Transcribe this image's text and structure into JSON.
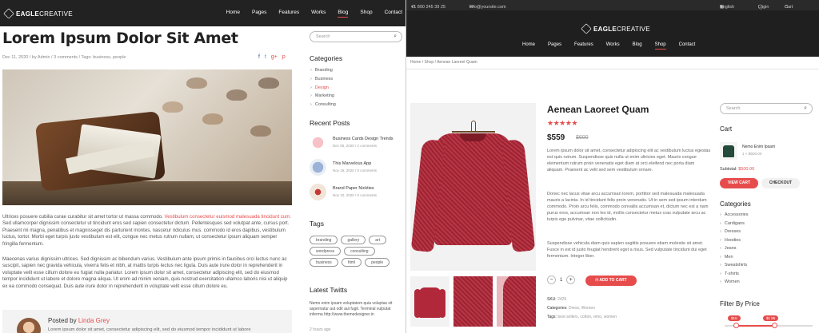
{
  "left": {
    "logo": {
      "bold": "EAGLE",
      "thin": "CREATIVE"
    },
    "nav": [
      "Home",
      "Pages",
      "Features",
      "Works",
      "Blog",
      "Shop",
      "Contact"
    ],
    "nav_active": "Blog",
    "post_title": "Lorem Ipsum Dolor Sit Amet",
    "meta": "Dec 11, 2020 / by Admin / 3 comments / Tags: business, people",
    "share_icons": [
      "facebook-icon",
      "twitter-icon",
      "google-plus-icon",
      "pinterest-icon"
    ],
    "share_glyphs": [
      "f",
      "t",
      "g+",
      "p"
    ],
    "para1_a": "Ultrices posuere cubilia curae curabitur sit amet tortor ut massa commodo. ",
    "para1_link": "Vestibulum consectetur euismod malesuada tincidunt cum.",
    "para1_b": " Sed ullamcorper dignissim consectetur ut tincidunt eros sed sapien consectetur dictum. Pellentesques sed volutpat ante, cursus port. Praesent mi magna, penatibus et magnisseget dis parturient montes, nascetur ridiculus mus. commodo id eros dapibus, vestibulum luctus, tortor. Morbi eget turpis justo vestibulum est elit, congue nec metus rutrum nullam, ut consectetur ipsum aliquam semper fringilla fermentum.",
    "para2": "Maecenas varius dignissim ultrices. Sed dignissim ac bibendum varius. Vestibulum ante ipsum primis in faucibus orci luctus nunc ac suscipit, sapien nec gravida vehicula, viverra felis et nibh, at mattis turpis lectus nec ligula. Duis aute irure dolor in reprehenderit in voluptate velit esse cillum dolore eu fugiat nulla pariatur. Lorem ipsum dolor sit amet, consectetur adipiscing elit, sed do eiusmod tempor incididunt ut labore et dolore magna aliqua. Ut enim ad minim veniam, quis nostrud exercitation ullamco laboris nisi ut aliquip ex ea commodo consequat. Duis aute irure dolor in reprehenderit in voluptate velit esse cillum dolore eu.",
    "author": {
      "posted_by": "Posted by ",
      "name": "Linda Grey",
      "text": "Lorem ipsum dolor sit amet, consectetur adipiscing elit, sed do eiusmod tempor incididunt ut labore"
    },
    "sidebar": {
      "search_placeholder": "Search",
      "categories_title": "Categories",
      "categories": [
        "Branding",
        "Business",
        "Design",
        "Marketing",
        "Consulting"
      ],
      "categories_active": "Design",
      "recent_title": "Recent Posts",
      "recent": [
        {
          "title": "Business Cards Design Trends",
          "date": "Dec 05, 2020 / 2 comments"
        },
        {
          "title": "This Marvelous App",
          "date": "Nov 16, 2020 / 0 comments"
        },
        {
          "title": "Brand Paper Nickties",
          "date": "Nov 10, 2020 / 0 comments"
        }
      ],
      "tags_title": "Tags",
      "tags": [
        "branding",
        "gallery",
        "art",
        "wordpress",
        "consulting",
        "business",
        "html",
        "people"
      ],
      "twitts_title": "Latest Twitts",
      "twitt": "Nemo enim ipsam voluptatem quia voluptas sit aspernatur aut odit aut fugit. Terminal vulputat inferma http://www.themedesigner.in",
      "twitt_time": "2 hours ago"
    }
  },
  "right": {
    "topbar": {
      "phone": "+1 800 245 39 25",
      "email": "info@yoursite.com",
      "language": "English",
      "login": "Login",
      "cart": "Cart"
    },
    "logo": {
      "bold": "EAGLE",
      "thin": "CREATIVE"
    },
    "nav": [
      "Home",
      "Pages",
      "Features",
      "Works",
      "Blog",
      "Shop",
      "Contact"
    ],
    "nav_active": "Shop",
    "breadcrumb": "Home / Shop / Aenean Laoreet Quam",
    "product": {
      "title": "Aenean Laoreet Quam",
      "rating": 4.5,
      "rating_max": 5,
      "price": "$559",
      "old_price": "$600",
      "desc1": "Lorem ipsum dolor sit amet, consectetur adipiscing elit ac vestibulum luctus egestas est quis rutrum. Suspendisse quis nulla ut enim ultricies eget. Mauris congue elementum rutrum proin venenatis eget diam at orci eleifend nec porta diam aliquam. Praesent ac velit sed sem vestibulum ornare.",
      "desc2": "Donec nec lacus vitae arcu accumsan lorem, porttitor sed malesuada malesuada mauris a lacinia. In id tincidunt felis proin venenatis. Ut in sem sed ipsum interdum commodo. Proin arcu felis, commodo convallis accumsan et, dictum nec est a nam purus eros, accumsan non leo id, mollis consectetur metus cras vulputate arcu ac turpis ege pulvinar, vitae sollicitudin.",
      "desc3": "Suspendisse vehicula diam quis sapien sagittis posuere etiam molestie sit amet. Fusce in est id justo feugiat hendrerit eget a risus. Sed vulputate tincidunt dui eget fermentum. Integer liber.",
      "qty": "1",
      "add_to_cart": "ADD TO CART",
      "sku_label": "SKU:",
      "sku": "2429",
      "categories_label": "Categories:",
      "categories": "Dress, Women",
      "tags_label": "Tags:",
      "tags": "best sellers, cotton, retro, women"
    },
    "sidebar": {
      "search_placeholder": "Search",
      "cart_title": "Cart",
      "cart_item": "Nemo Enim Ipsam",
      "cart_item_price": "1 × $500.00",
      "subtotal_label": "Subtotal: ",
      "subtotal": "$500.00",
      "view_cart": "VIEW CART",
      "checkout": "CHECKOUT",
      "categories_title": "Categories",
      "categories": [
        "Accessories",
        "Cardigans",
        "Dresses",
        "Hoodies",
        "Jeans",
        "Men",
        "Sweatshirts",
        "T-shirts",
        "Women"
      ],
      "filter_title": "Filter By Price",
      "price_min": "$15",
      "price_max": "$1 85"
    },
    "colors": {
      "accent": "#e74c4c",
      "nav_bg": "#1f1f1f"
    }
  }
}
